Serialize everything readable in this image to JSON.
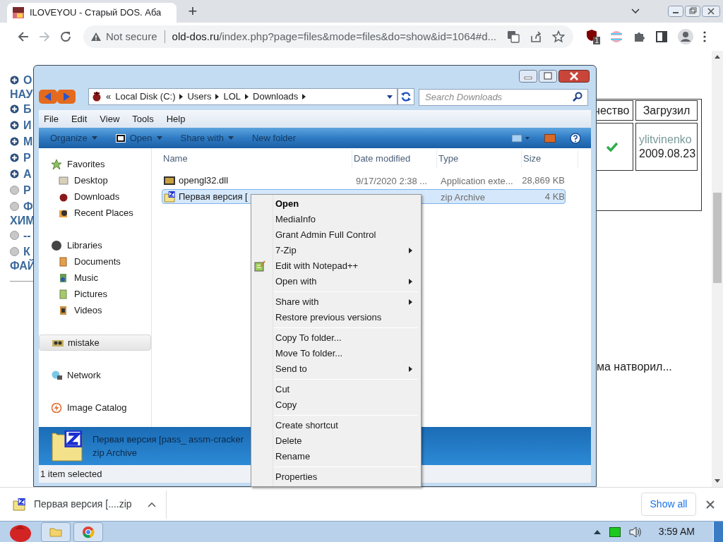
{
  "browser": {
    "tabs": [
      {
        "title": "ILOVEYOU - Старый DOS. Аба",
        "selected": true
      }
    ],
    "new_tab": "+",
    "address": {
      "security": "Not secure",
      "domain": "old-dos.ru",
      "path": "/index.php?page=files&mode=files&do=show&id=1064#d..."
    },
    "extension_badge": "1"
  },
  "page": {
    "nav_links": [
      {
        "text": "О",
        "kind": "plus"
      },
      {
        "text": "НАУ",
        "kind": "cont"
      },
      {
        "text": "Б",
        "kind": "plus"
      },
      {
        "text": "И",
        "kind": "plus"
      },
      {
        "text": "М",
        "kind": "plus"
      },
      {
        "text": "Р",
        "kind": "plus"
      },
      {
        "text": "А",
        "kind": "plus"
      },
      {
        "text": "Р",
        "kind": "dot"
      },
      {
        "text": "Ф",
        "kind": "dot"
      },
      {
        "text": "ХИМ",
        "kind": "cont"
      },
      {
        "text": "--",
        "kind": "dot"
      },
      {
        "text": "К",
        "kind": "dot"
      },
      {
        "text": "ФАЙ",
        "kind": "cont"
      }
    ],
    "table": {
      "columns": [
        "чество",
        "Загрузил"
      ],
      "rows": [
        {
          "approved": true,
          "uploader": "ylitvinenko",
          "date": "2009.08.23"
        }
      ]
    },
    "comment": "ма натворил..."
  },
  "explorer": {
    "overflow": "«",
    "breadcrumb": [
      "Local Disk (C:)",
      "Users",
      "LOL",
      "Downloads"
    ],
    "search_placeholder": "Search Downloads",
    "menu": [
      "File",
      "Edit",
      "View",
      "Tools",
      "Help"
    ],
    "toolbar": [
      {
        "label": "Organize",
        "kind": "dropdown"
      },
      {
        "label": "Open",
        "kind": "open"
      },
      {
        "label": "Share with",
        "kind": "dropdown"
      },
      {
        "label": "New folder",
        "kind": "plain"
      }
    ],
    "nav": [
      {
        "label": "Favorites",
        "selected": false,
        "children": [
          {
            "label": "Desktop",
            "selected": false
          },
          {
            "label": "Downloads",
            "selected": false
          },
          {
            "label": "Recent Places",
            "selected": false
          }
        ]
      },
      {
        "label": "Libraries",
        "selected": false,
        "children": [
          {
            "label": "Documents",
            "selected": false
          },
          {
            "label": "Music",
            "selected": false
          },
          {
            "label": "Pictures",
            "selected": false
          },
          {
            "label": "Videos",
            "selected": false
          }
        ]
      },
      {
        "label": "mistake",
        "selected": true
      },
      {
        "label": "Network",
        "selected": false
      },
      {
        "label": "Image Catalog",
        "selected": false
      }
    ],
    "columns": [
      "Name",
      "Date modified",
      "Type",
      "Size"
    ],
    "files": [
      {
        "name": "opengl32.dll",
        "date": "9/17/2020 2:38 ...",
        "type": "Application exte...",
        "size": "28,869 KB",
        "selected": false
      },
      {
        "name": "Первая версия [",
        "type": "zip Archive",
        "size": "4 KB",
        "selected": true
      }
    ],
    "details": {
      "name": "Первая версия [pass_ assm-cracker",
      "type": "zip Archive"
    },
    "status": "1 item selected"
  },
  "context_menu": {
    "groups": [
      [
        {
          "label": "Open",
          "kind": "default"
        },
        {
          "label": "MediaInfo",
          "kind": "plain"
        },
        {
          "label": "Grant Admin Full Control",
          "kind": "plain"
        },
        {
          "label": "7-Zip",
          "kind": "submenu"
        },
        {
          "label": "Edit with Notepad++",
          "kind": "icon"
        },
        {
          "label": "Open with",
          "kind": "submenu"
        }
      ],
      [
        {
          "label": "Share with",
          "kind": "submenu"
        },
        {
          "label": "Restore previous versions",
          "kind": "plain"
        }
      ],
      [
        {
          "label": "Copy To folder...",
          "kind": "plain"
        },
        {
          "label": "Move To folder...",
          "kind": "plain"
        },
        {
          "label": "Send to",
          "kind": "submenu"
        }
      ],
      [
        {
          "label": "Cut",
          "kind": "plain"
        },
        {
          "label": "Copy",
          "kind": "plain"
        }
      ],
      [
        {
          "label": "Create shortcut",
          "kind": "plain"
        },
        {
          "label": "Delete",
          "kind": "plain"
        },
        {
          "label": "Rename",
          "kind": "plain"
        }
      ],
      [
        {
          "label": "Properties",
          "kind": "plain"
        }
      ]
    ]
  },
  "downloads": {
    "item": "Первая версия [....zip",
    "show_all": "Show all"
  },
  "taskbar": {
    "clock": "3:59 AM"
  }
}
